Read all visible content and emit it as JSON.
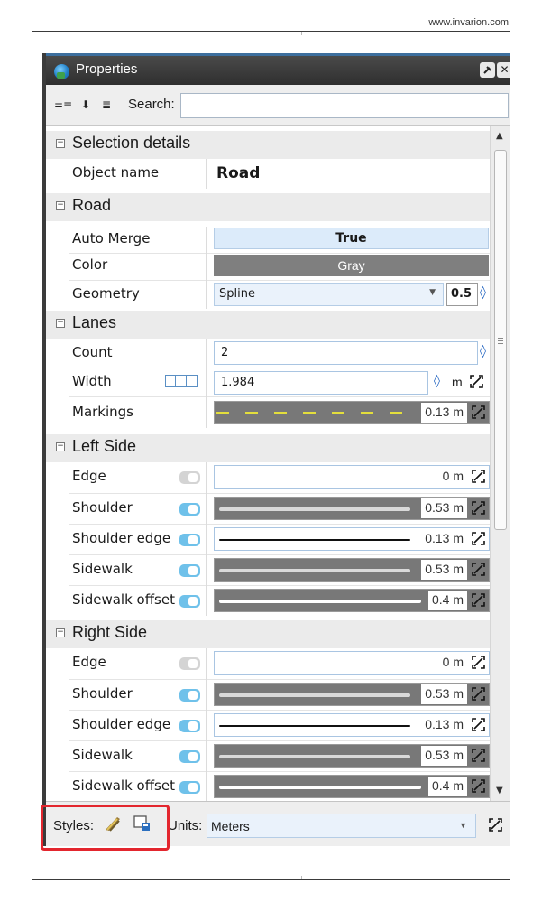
{
  "credit": "www.invarion.com",
  "panel": {
    "title": "Properties"
  },
  "toolbar": {
    "search_label": "Search:",
    "search_value": ""
  },
  "categories": {
    "selection": "Selection details",
    "road": "Road",
    "lanes": "Lanes",
    "left": "Left Side",
    "right": "Right Side"
  },
  "selection": {
    "object_name_label": "Object name",
    "object_name_value": "Road"
  },
  "road": {
    "auto_merge_label": "Auto Merge",
    "auto_merge_value": "True",
    "color_label": "Color",
    "color_value": "Gray",
    "geometry_label": "Geometry",
    "geometry_value": "Spline",
    "geometry_num": "0.5"
  },
  "lanes": {
    "count_label": "Count",
    "count_value": "2",
    "width_label": "Width",
    "width_value": "1.984",
    "width_unit": "m",
    "markings_label": "Markings",
    "markings_value": "0.13 m"
  },
  "left_side": [
    {
      "label": "Edge",
      "toggle": "off",
      "style": "white-empty",
      "value": "0 m"
    },
    {
      "label": "Shoulder",
      "toggle": "on",
      "style": "dark",
      "value": "0.53 m"
    },
    {
      "label": "Shoulder edge",
      "toggle": "on",
      "style": "white-line",
      "value": "0.13 m"
    },
    {
      "label": "Sidewalk",
      "toggle": "on",
      "style": "dark",
      "value": "0.53 m"
    },
    {
      "label": "Sidewalk offset",
      "toggle": "on",
      "style": "dark-white",
      "value": "0.4 m"
    }
  ],
  "right_side": [
    {
      "label": "Edge",
      "toggle": "off",
      "style": "white-empty",
      "value": "0 m"
    },
    {
      "label": "Shoulder",
      "toggle": "on",
      "style": "dark",
      "value": "0.53 m"
    },
    {
      "label": "Shoulder edge",
      "toggle": "on",
      "style": "white-line",
      "value": "0.13 m"
    },
    {
      "label": "Sidewalk",
      "toggle": "on",
      "style": "dark",
      "value": "0.53 m"
    },
    {
      "label": "Sidewalk offset",
      "toggle": "on",
      "style": "dark-white",
      "value": "0.4 m"
    }
  ],
  "bottom": {
    "styles_label": "Styles:",
    "units_label": "Units:",
    "units_value": "Meters"
  },
  "colors": {
    "accent": "#3d6f9e",
    "toggle_on": "#6fc1ea",
    "highlight": "#e3262e",
    "gray_fill": "#7f7f7f"
  }
}
